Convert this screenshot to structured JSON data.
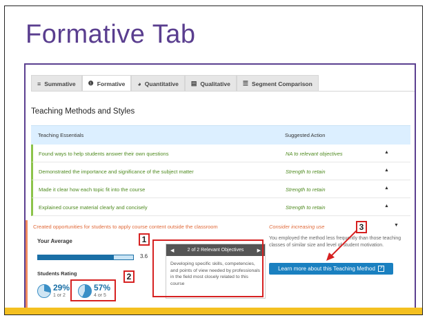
{
  "slide": {
    "title": "Formative Tab"
  },
  "tabs": [
    {
      "label": "Summative",
      "icon": "bars-icon",
      "glyph": "≡"
    },
    {
      "label": "Formative",
      "icon": "info-icon",
      "glyph": "❶"
    },
    {
      "label": "Quantitative",
      "icon": "pie-icon",
      "glyph": "◕"
    },
    {
      "label": "Qualitative",
      "icon": "doc-icon",
      "glyph": "▤"
    },
    {
      "label": "Segment Comparison",
      "icon": "lines-icon",
      "glyph": "☰"
    }
  ],
  "section": {
    "title": "Teaching Methods and Styles"
  },
  "table": {
    "col1": "Teaching Essentials",
    "col2": "Suggested Action",
    "rows": [
      {
        "text": "Found ways to help students answer their own questions",
        "action": "NA to relevant objectives"
      },
      {
        "text": "Demonstrated the importance and significance of the subject matter",
        "action": "Strength to retain"
      },
      {
        "text": "Made it clear how each topic fit into the course",
        "action": "Strength to retain"
      },
      {
        "text": "Explained course material clearly and concisely",
        "action": "Strength to retain"
      }
    ],
    "chevron_up": "▲",
    "chevron_down": "▼"
  },
  "detail": {
    "title": "Created opportunities for students to apply course content outside the classroom",
    "action": "Consider increasing use",
    "avg_label": "Your Average",
    "avg_value": "3.6",
    "avg_fraction": 0.8,
    "rating_label": "Students Rating",
    "rating1": {
      "pct": "29%",
      "sub": "1 or 2",
      "fraction": 0.29
    },
    "rating2": {
      "pct": "57%",
      "sub": "4 or 5",
      "fraction": 0.57
    },
    "objectives_nav": "2 of 2 Relevant Objectives",
    "prev": "◀",
    "next": "▶",
    "objective_text": "Developing specific skills, competencies, and points of view needed by professionals in the field most closely related to this course",
    "explanation": "You employed the method less frequently than those teaching classes of similar size and level of student motivation.",
    "learn_button": "Learn more about this Teaching Method"
  },
  "callouts": {
    "one": "1",
    "two": "2",
    "three": "3"
  },
  "colors": {
    "accent_purple": "#5a3e8f",
    "callout_red": "#d62020",
    "button_blue": "#1a80c0",
    "strength_green": "#4e8a1f",
    "increase_orange": "#e06a3a"
  }
}
